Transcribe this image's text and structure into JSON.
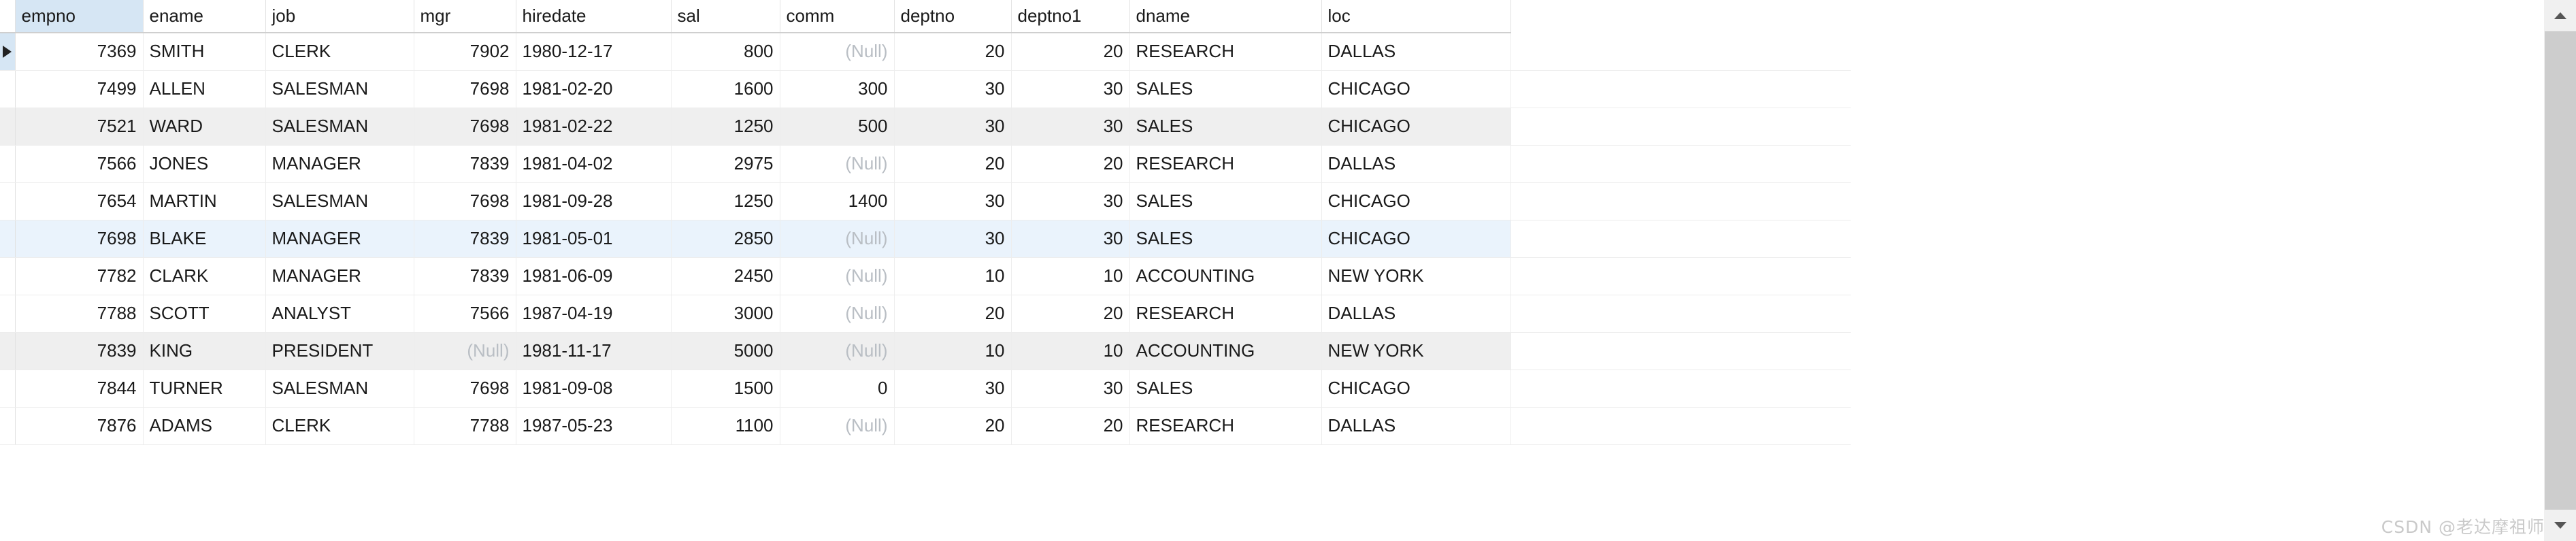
{
  "grid": {
    "columns": [
      {
        "key": "empno",
        "label": "empno",
        "align": "num",
        "selected": true
      },
      {
        "key": "ename",
        "label": "ename",
        "align": "txt",
        "selected": false
      },
      {
        "key": "job",
        "label": "job",
        "align": "txt",
        "selected": false
      },
      {
        "key": "mgr",
        "label": "mgr",
        "align": "num",
        "selected": false
      },
      {
        "key": "hiredate",
        "label": "hiredate",
        "align": "txt",
        "selected": false
      },
      {
        "key": "sal",
        "label": "sal",
        "align": "num",
        "selected": false
      },
      {
        "key": "comm",
        "label": "comm",
        "align": "num",
        "selected": false
      },
      {
        "key": "deptno",
        "label": "deptno",
        "align": "num",
        "selected": false
      },
      {
        "key": "deptno1",
        "label": "deptno1",
        "align": "num",
        "selected": false
      },
      {
        "key": "dname",
        "label": "dname",
        "align": "txt",
        "selected": false
      },
      {
        "key": "loc",
        "label": "loc",
        "align": "txt",
        "selected": false
      }
    ],
    "null_text": "(Null)",
    "row_marker_icon": "play-triangle-icon",
    "rows": [
      {
        "state": "current",
        "cells": [
          "7369",
          "SMITH",
          "CLERK",
          "7902",
          "1980-12-17",
          "800",
          "(Null)",
          "20",
          "20",
          "RESEARCH",
          "DALLAS"
        ]
      },
      {
        "state": "plain",
        "cells": [
          "7499",
          "ALLEN",
          "SALESMAN",
          "7698",
          "1981-02-20",
          "1600",
          "300",
          "30",
          "30",
          "SALES",
          "CHICAGO"
        ]
      },
      {
        "state": "alt",
        "cells": [
          "7521",
          "WARD",
          "SALESMAN",
          "7698",
          "1981-02-22",
          "1250",
          "500",
          "30",
          "30",
          "SALES",
          "CHICAGO"
        ]
      },
      {
        "state": "plain",
        "cells": [
          "7566",
          "JONES",
          "MANAGER",
          "7839",
          "1981-04-02",
          "2975",
          "(Null)",
          "20",
          "20",
          "RESEARCH",
          "DALLAS"
        ]
      },
      {
        "state": "plain",
        "cells": [
          "7654",
          "MARTIN",
          "SALESMAN",
          "7698",
          "1981-09-28",
          "1250",
          "1400",
          "30",
          "30",
          "SALES",
          "CHICAGO"
        ]
      },
      {
        "state": "sel",
        "cells": [
          "7698",
          "BLAKE",
          "MANAGER",
          "7839",
          "1981-05-01",
          "2850",
          "(Null)",
          "30",
          "30",
          "SALES",
          "CHICAGO"
        ]
      },
      {
        "state": "plain",
        "cells": [
          "7782",
          "CLARK",
          "MANAGER",
          "7839",
          "1981-06-09",
          "2450",
          "(Null)",
          "10",
          "10",
          "ACCOUNTING",
          "NEW YORK"
        ]
      },
      {
        "state": "plain",
        "cells": [
          "7788",
          "SCOTT",
          "ANALYST",
          "7566",
          "1987-04-19",
          "3000",
          "(Null)",
          "20",
          "20",
          "RESEARCH",
          "DALLAS"
        ]
      },
      {
        "state": "alt",
        "cells": [
          "7839",
          "KING",
          "PRESIDENT",
          "(Null)",
          "1981-11-17",
          "5000",
          "(Null)",
          "10",
          "10",
          "ACCOUNTING",
          "NEW YORK"
        ]
      },
      {
        "state": "plain",
        "cells": [
          "7844",
          "TURNER",
          "SALESMAN",
          "7698",
          "1981-09-08",
          "1500",
          "0",
          "30",
          "30",
          "SALES",
          "CHICAGO"
        ]
      },
      {
        "state": "plain",
        "cells": [
          "7876",
          "ADAMS",
          "CLERK",
          "7788",
          "1987-05-23",
          "1100",
          "(Null)",
          "20",
          "20",
          "RESEARCH",
          "DALLAS"
        ]
      }
    ]
  },
  "scrollbar": {
    "up_icon": "chevron-up-icon",
    "down_icon": "chevron-down-icon"
  },
  "watermark": {
    "text": "CSDN @老达摩祖师"
  },
  "colors": {
    "header_selected_bg": "#d6e6f4",
    "row_alt_bg": "#efefef",
    "row_selected_bg": "#eaf3fc",
    "null_text": "#b9bec4",
    "grid_line": "#ededed",
    "scrollbar_track": "#f0f0f0",
    "scrollbar_thumb": "#cdcdcd"
  }
}
